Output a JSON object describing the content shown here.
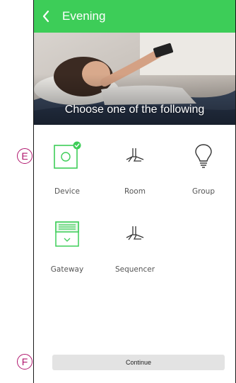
{
  "header": {
    "title": "Evening"
  },
  "hero": {
    "caption": "Choose one of the following"
  },
  "options": [
    {
      "label": "Device",
      "icon": "device-icon",
      "selected": true
    },
    {
      "label": "Room",
      "icon": "ceiling-fan-icon",
      "selected": false
    },
    {
      "label": "Group",
      "icon": "lightbulb-icon",
      "selected": false
    },
    {
      "label": "Gateway",
      "icon": "gateway-icon",
      "selected": false
    },
    {
      "label": "Sequencer",
      "icon": "ceiling-fan-icon",
      "selected": false
    }
  ],
  "continue_label": "Continue",
  "callouts": {
    "e": "E",
    "f": "F"
  },
  "colors": {
    "accent": "#3dcd58",
    "callout": "#b0166d"
  }
}
